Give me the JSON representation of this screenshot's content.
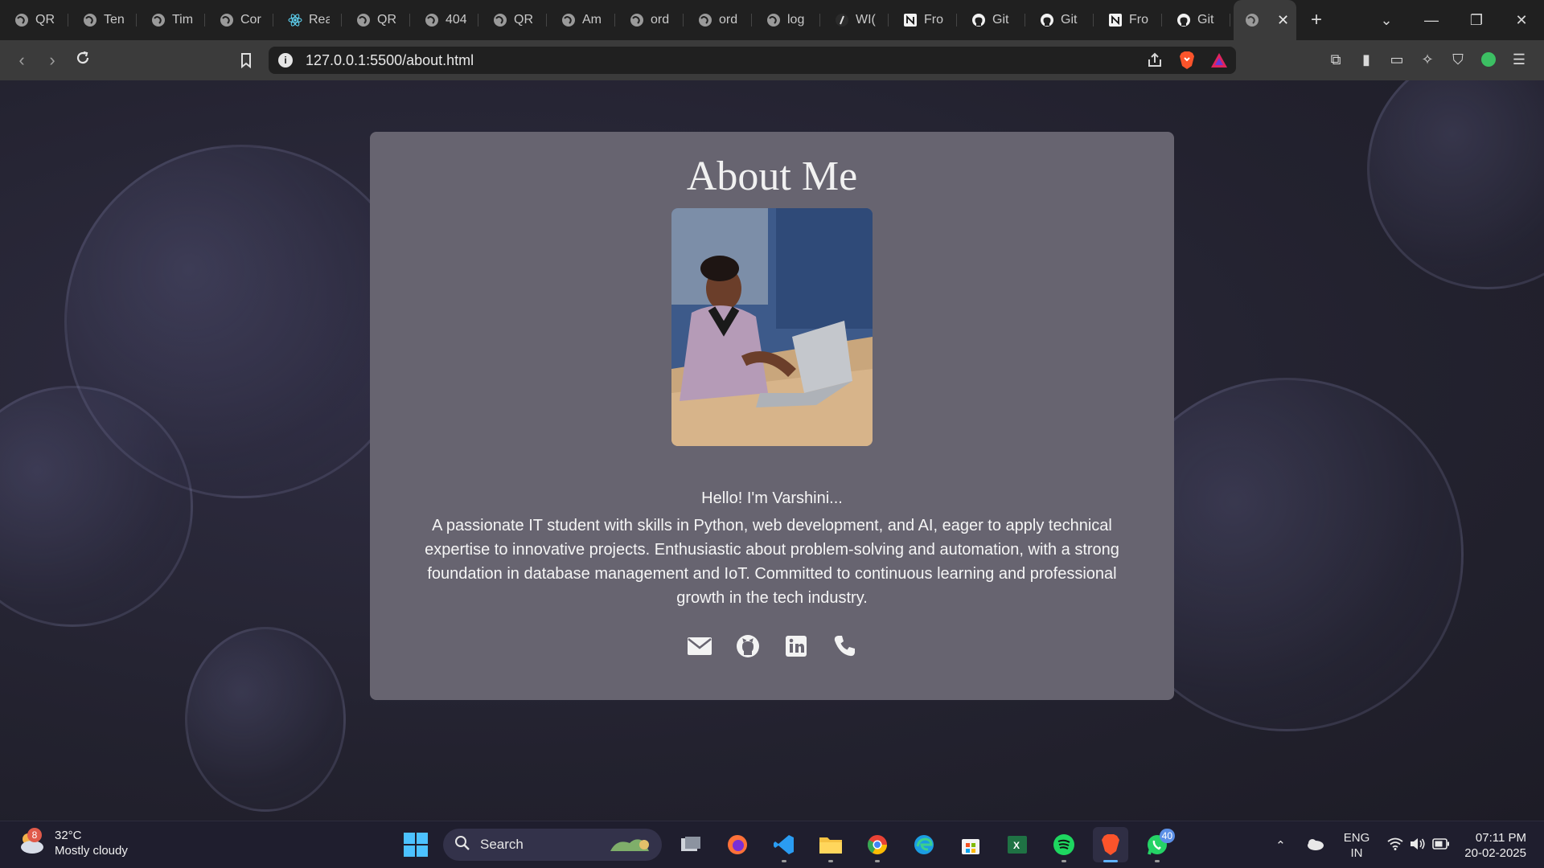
{
  "browser": {
    "tabs": [
      {
        "label": "QR",
        "icon": "globe-icon"
      },
      {
        "label": "Ten",
        "icon": "globe-icon"
      },
      {
        "label": "Tim",
        "icon": "globe-icon"
      },
      {
        "label": "Cor",
        "icon": "globe-icon"
      },
      {
        "label": "Rea",
        "icon": "react-icon"
      },
      {
        "label": "QR",
        "icon": "globe-icon"
      },
      {
        "label": "404",
        "icon": "globe-icon"
      },
      {
        "label": "QR",
        "icon": "globe-icon"
      },
      {
        "label": "Am",
        "icon": "globe-icon"
      },
      {
        "label": "ord",
        "icon": "globe-icon"
      },
      {
        "label": "ord",
        "icon": "globe-icon"
      },
      {
        "label": "log",
        "icon": "globe-icon"
      },
      {
        "label": "WI(",
        "icon": "wix-icon"
      },
      {
        "label": "Fro",
        "icon": "notion-icon"
      },
      {
        "label": "Git",
        "icon": "github-icon"
      },
      {
        "label": "Git",
        "icon": "github-icon"
      },
      {
        "label": "Fro",
        "icon": "notion-icon"
      },
      {
        "label": "Git",
        "icon": "github-icon"
      }
    ],
    "url": "127.0.0.1:5500/about.html",
    "accent": "#fb542b"
  },
  "page": {
    "title": "About Me",
    "greeting": "Hello! I'm Varshini...",
    "bio": "A passionate IT student with skills in Python, web development, and AI, eager to apply technical expertise to innovative projects. Enthusiastic about problem-solving and automation, with a strong foundation in database management and IoT. Committed to continuous learning and professional growth in the tech industry.",
    "socials": [
      "envelope-icon",
      "github-icon",
      "linkedin-icon",
      "phone-icon"
    ],
    "card_color": "#676470"
  },
  "taskbar": {
    "weather": {
      "temp": "32°C",
      "desc": "Mostly cloudy",
      "alert_count": "8"
    },
    "search_placeholder": "Search",
    "whatsapp_badge": "40",
    "lang": "ENG",
    "region": "IN",
    "time": "07:11 PM",
    "date": "20-02-2025"
  }
}
